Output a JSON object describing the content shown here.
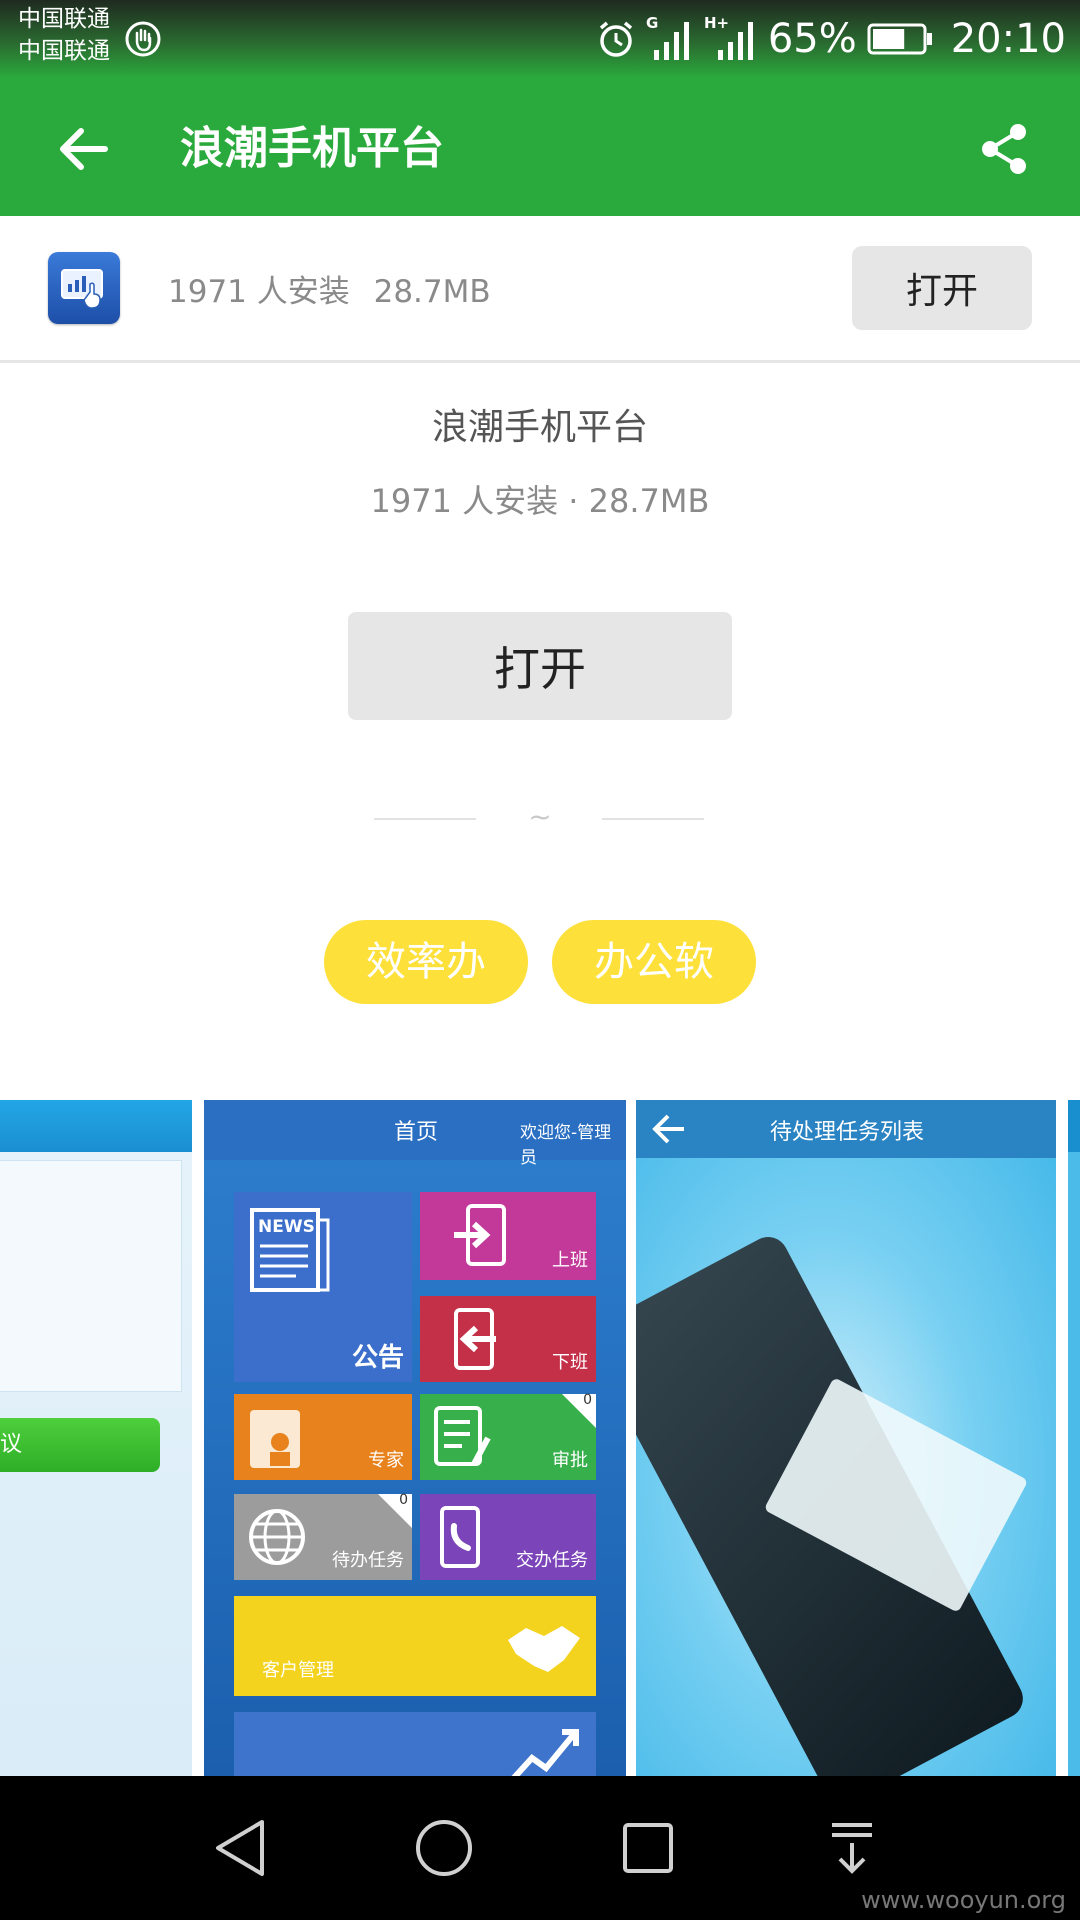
{
  "status_bar": {
    "carrier_1": "中国联通",
    "carrier_2": "中国联通",
    "network_1": "G",
    "network_2": "H+",
    "battery_percent": "65%",
    "battery_level": 0.65,
    "time": "20:10",
    "icons": [
      "hand-icon",
      "alarm-icon",
      "signal-icon",
      "signal-icon",
      "battery-icon"
    ]
  },
  "app_bar": {
    "title": "浪潮手机平台",
    "back_icon": "arrow-left-icon",
    "share_icon": "share-icon",
    "background": "#2aaa3c"
  },
  "header_strip": {
    "installs": "1971 人安装",
    "size": "28.7MB",
    "open_label": "打开"
  },
  "detail": {
    "title": "浪潮手机平台",
    "meta": "1971 人安装 · 28.7MB",
    "open_label": "打开",
    "divider_symbol": "~"
  },
  "tags": [
    "效率办公",
    "办公软件"
  ],
  "tag_color": "#fde03a",
  "screenshots": {
    "shot1": {
      "button_text": "议"
    },
    "shot2": {
      "header_title": "首页",
      "header_user": "欢迎您-管理员",
      "tiles": {
        "news": "公告",
        "clock_in": "上班",
        "clock_out": "下班",
        "expert": "专家",
        "approve": "审批",
        "todo": "待办任务",
        "handover": "交办任务",
        "crm": "客户管理"
      },
      "approve_badge": "0",
      "todo_badge": "0",
      "news_icon_text": "NEWS"
    },
    "shot3": {
      "header_title": "待处理任务列表"
    }
  },
  "nav_bar": {
    "icons": [
      "nav-back-icon",
      "nav-home-icon",
      "nav-recents-icon",
      "nav-notification-icon"
    ]
  },
  "watermark": "www.wooyun.org"
}
